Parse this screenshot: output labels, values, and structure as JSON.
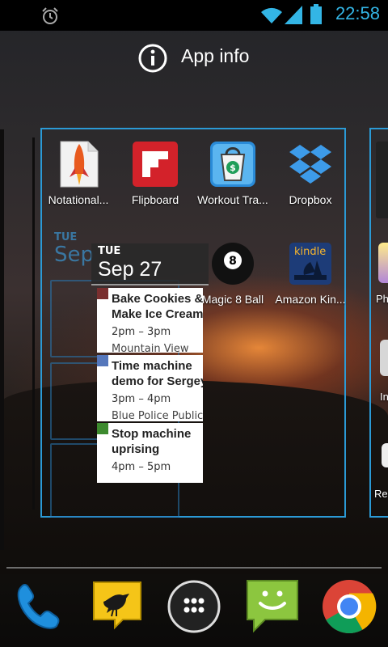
{
  "status_bar": {
    "time": "22:58",
    "icons": [
      "alarm-icon",
      "wifi-icon",
      "cell-signal-icon",
      "battery-icon"
    ],
    "accent_color": "#33b5e5"
  },
  "drop_target": {
    "label": "App info",
    "icon": "info-icon"
  },
  "apps": [
    {
      "label": "Notational...",
      "icon": "notational-velocity-icon"
    },
    {
      "label": "Flipboard",
      "icon": "flipboard-icon"
    },
    {
      "label": "Workout Tra...",
      "icon": "workout-trainer-icon"
    },
    {
      "label": "Dropbox",
      "icon": "dropbox-icon"
    },
    {
      "label": "Magic 8 Ball",
      "icon": "magic-8-ball-icon"
    },
    {
      "label": "Amazon Kin...",
      "icon": "kindle-icon"
    }
  ],
  "next_page_labels": [
    "Ph",
    "In",
    "Re"
  ],
  "calendar_widget": {
    "day_of_week": "TUE",
    "month_day": "Sep 27",
    "events": [
      {
        "title_line1": "Bake Cookies &",
        "title_line2": "Make Ice Cream",
        "time": "2pm – 3pm",
        "location": "Mountain View",
        "color": "#7a2f2f"
      },
      {
        "title_line1": "Time machine",
        "title_line2": "demo for Sergey",
        "time": "3pm – 4pm",
        "location": "Blue Police Public",
        "color": "#5577bb"
      },
      {
        "title_line1": "Stop machine",
        "title_line2": "uprising",
        "time": "4pm – 5pm",
        "location": "",
        "color": "#3d8a2e"
      }
    ],
    "ghost_header": "TUE",
    "ghost_date": "Sep"
  },
  "dock": [
    {
      "name": "phone",
      "icon": "phone-icon"
    },
    {
      "name": "tweetdeck",
      "icon": "tweetdeck-bird-icon"
    },
    {
      "name": "app drawer",
      "icon": "all-apps-icon"
    },
    {
      "name": "messaging",
      "icon": "messaging-icon"
    },
    {
      "name": "chrome",
      "icon": "chrome-icon"
    }
  ],
  "kindle_text": "kindle"
}
